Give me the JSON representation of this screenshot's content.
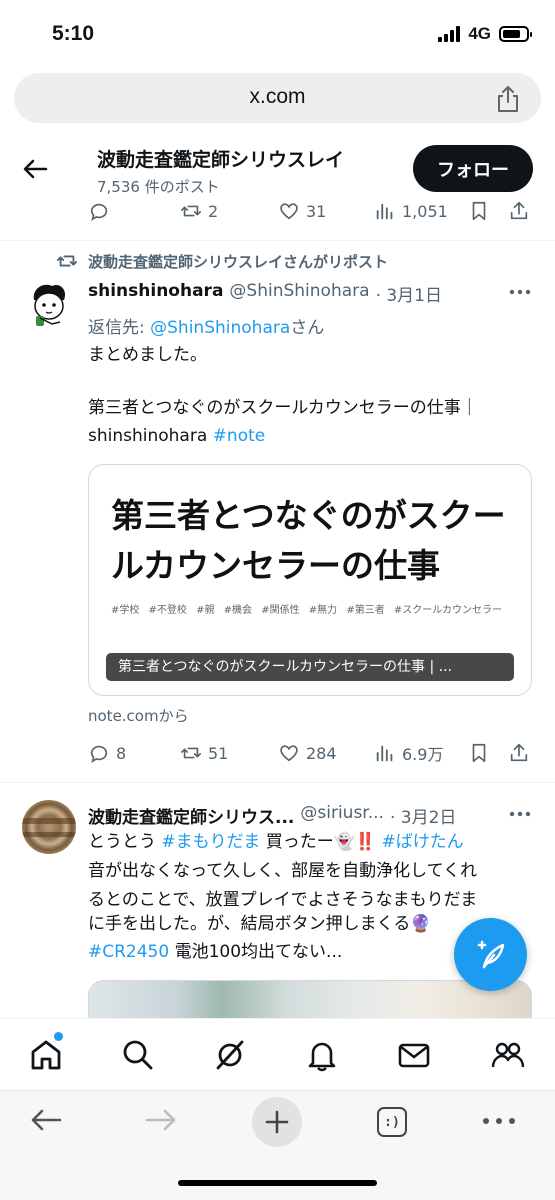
{
  "status_bar": {
    "time": "5:10",
    "network": "4G"
  },
  "browser": {
    "url": "x.com"
  },
  "profile_header": {
    "name": "波動走査鑑定師シリウスレイ",
    "post_count": "7,536 件のポスト",
    "follow_label": "フォロー"
  },
  "prev_tweet_actions": {
    "reposts": "2",
    "likes": "31",
    "views": "1,051"
  },
  "tweet1": {
    "repost_label": "波動走査鑑定師シリウスレイさんがリポスト",
    "name": "shinshinohara",
    "handle": "@ShinShinohara",
    "date": "· 3月1日",
    "reply_prefix": "返信先: ",
    "reply_handle": "@ShinShinohara",
    "reply_suffix": "さん",
    "line1": "まとめました。",
    "line2": "第三者とつなぐのがスクールカウンセラーの仕事｜",
    "line3_text": "shinshinohara ",
    "line3_tag": "#note",
    "card": {
      "title": "第三者とつなぐのがスクールカウンセラーの仕事",
      "tags": "#学校 #不登校 #親 #機会 #関係性 #無力 #第三者 #スクールカウンセラー",
      "caption": "第三者とつなぐのがスクールカウンセラーの仕事 | ...",
      "domain": "note.comから"
    },
    "actions": {
      "replies": "8",
      "reposts": "51",
      "likes": "284",
      "views": "6.9万"
    }
  },
  "tweet2": {
    "name": "波動走査鑑定師シリウス...",
    "handle": "@siriusr...",
    "date": "· 3月2日",
    "line1_pre": "とうとう ",
    "line1_tag1": "#まもりだま",
    "line1_mid": " 買ったー👻‼️ ",
    "line1_tag2": "#ばけたん",
    "line2": "音が出なくなって久しく、部屋を自動浄化してくれ",
    "line3": "るとのことで、放置プレイでよさそうなまもりだま",
    "line4": "に手を出した。が、結局ボタン押しまくる🔮",
    "line5_tag": "#CR2450",
    "line5_text": " 電池100均出てない..."
  },
  "colors": {
    "accent": "#1d9bf0",
    "text": "#0f1419",
    "muted": "#536471"
  }
}
